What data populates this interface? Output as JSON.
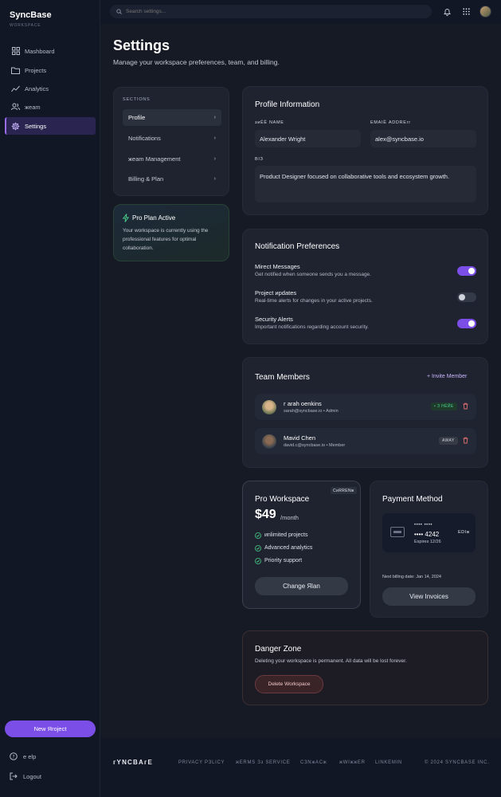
{
  "sidebar": {
    "brand": "SyncBase",
    "brand_sub": "WORKSPACE",
    "items": [
      {
        "label": "Mashboard",
        "icon": "grid-icon"
      },
      {
        "label": "Projects",
        "icon": "folder-icon"
      },
      {
        "label": "Analytics",
        "icon": "chart-icon"
      },
      {
        "label": "жeam",
        "icon": "users-icon"
      },
      {
        "label": "Settings",
        "icon": "gear-icon"
      }
    ],
    "new_project": "New Яroject",
    "help": "e elp",
    "logout": "Logout"
  },
  "topbar": {
    "search_placeholder": "Search settings..."
  },
  "page": {
    "title": "Settings",
    "subtitle": "Manage your workspace preferences, team, and billing."
  },
  "sections": {
    "label": "SECTIONS",
    "items": [
      {
        "label": "Profile",
        "chevron": "›"
      },
      {
        "label": "Notifications",
        "chevron": "›"
      },
      {
        "label": "жeam Management",
        "chevron": "›"
      },
      {
        "label": "Billing & Plan",
        "chevron": "›"
      }
    ]
  },
  "pro_plan": {
    "title": "Pro Plan Active",
    "desc": "Your workspace is currently using the professional features for optimal collaboration.",
    "accent": "#4ad28b"
  },
  "profile": {
    "title": "Profile Information",
    "name_label": "зиЁЁ NAME",
    "name_value": "Alexander Wright",
    "email_label": "EMAIЁ ADDREгг",
    "email_value": "alex@syncbase.io",
    "bio_label": "BIЗ",
    "bio_value": "Product Designer focused on collaborative tools and ecosystem growth."
  },
  "notifications": {
    "title": "Notification Preferences",
    "items": [
      {
        "title": "Mirect Messages",
        "desc": "Get notified when someone sends you a message.",
        "on": true
      },
      {
        "title": "Project иpdates",
        "desc": "Real-time alerts for changes in your active projects.",
        "on": false
      },
      {
        "title": "Security Alerts",
        "desc": "Important notifications regarding account security.",
        "on": true
      }
    ]
  },
  "team": {
    "title": "Team Members",
    "invite": "+ Invite Member",
    "members": [
      {
        "name": "г arah оenkins",
        "meta": "sarah@syncbase.io • Admin",
        "status": "• З НЁЙЕ"
      },
      {
        "name": "Mavid Chen",
        "meta": "david.c@syncbase.io • Member",
        "status": "AWAY"
      }
    ]
  },
  "plan": {
    "badge": "СиRRENж",
    "title": "Pro Workspace",
    "price": "$49",
    "period": "/month",
    "features": [
      "иnlimited projects",
      "Advanced analytics",
      "Priority support"
    ],
    "button": "Change Яlan"
  },
  "payment": {
    "title": "Payment Method",
    "card_dots": "•••• ••••",
    "card_last": "•••• 4242",
    "expires": "Expires 12/26",
    "edit": "EDIж",
    "next_billing": "Next billing date: Jan 14, 2024",
    "button": "View Invoices"
  },
  "danger": {
    "title": "Danger Zone",
    "desc": "Deleting your workspace is permanent. All data will be lost forever.",
    "button": "Delete Workspace"
  },
  "footer": {
    "logo": "гYNCBAгE",
    "links": [
      "PRIVACY PЗLICY",
      "жERMS Зз SERVICE",
      "СЗNжACж",
      "жWIжжER",
      "LINKEMIN"
    ],
    "copyright": "© 2024 SYNCBASE INC."
  },
  "colors": {
    "accent": "#7c4ee8",
    "online": "#4ad28b",
    "danger": "#e07070"
  }
}
